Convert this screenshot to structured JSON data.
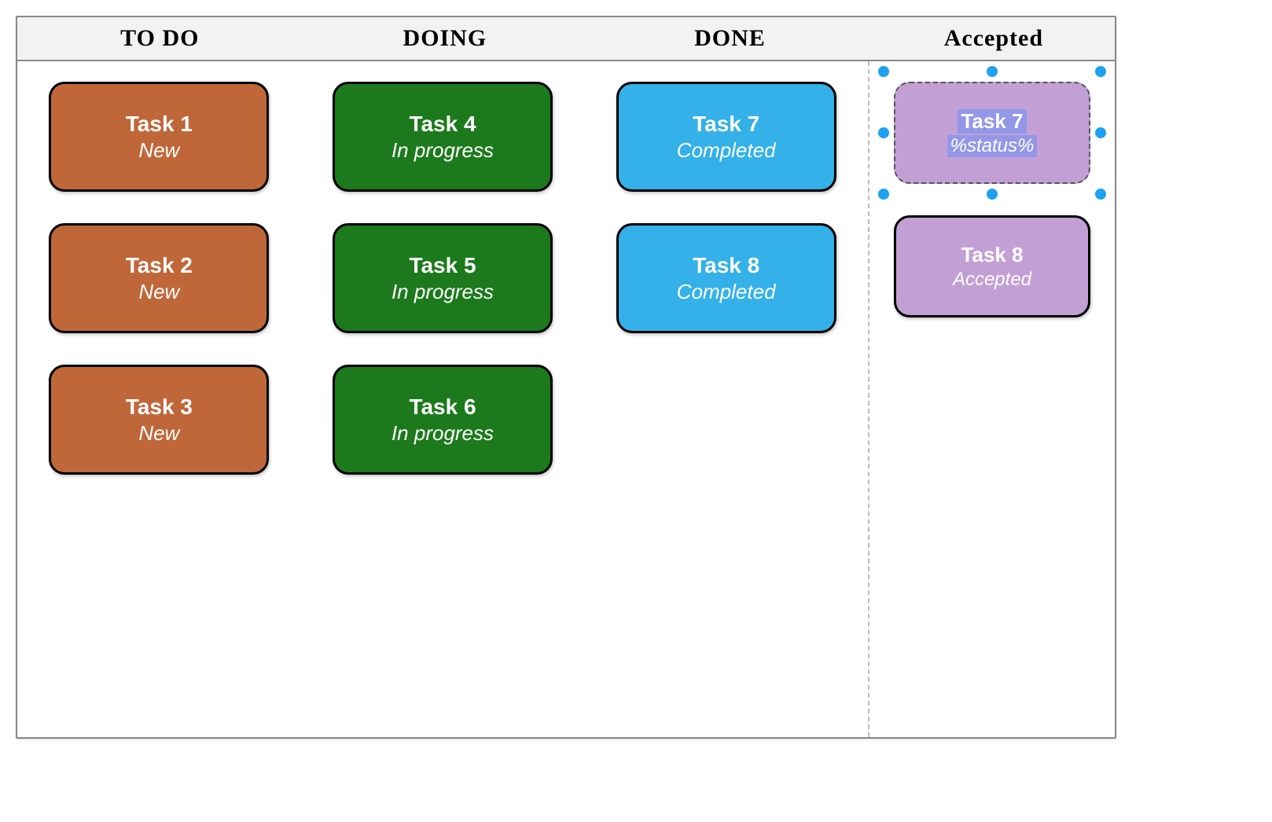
{
  "columns": [
    {
      "header": "TO DO",
      "class": "todo",
      "cards": [
        {
          "title": "Task 1",
          "status": "New"
        },
        {
          "title": "Task 2",
          "status": "New"
        },
        {
          "title": "Task 3",
          "status": "New"
        }
      ]
    },
    {
      "header": "DOING",
      "class": "doing",
      "cards": [
        {
          "title": "Task 4",
          "status": "In progress"
        },
        {
          "title": "Task 5",
          "status": "In progress"
        },
        {
          "title": "Task 6",
          "status": "In progress"
        }
      ]
    },
    {
      "header": "DONE",
      "class": "done",
      "cards": [
        {
          "title": "Task 7",
          "status": "Completed"
        },
        {
          "title": "Task 8",
          "status": "Completed"
        }
      ]
    },
    {
      "header": "Accepted",
      "class": "accepted",
      "cards": [
        {
          "title": "Task 7",
          "status": "%status%",
          "selected": true
        },
        {
          "title": "Task 8",
          "status": "Accepted"
        }
      ]
    }
  ]
}
